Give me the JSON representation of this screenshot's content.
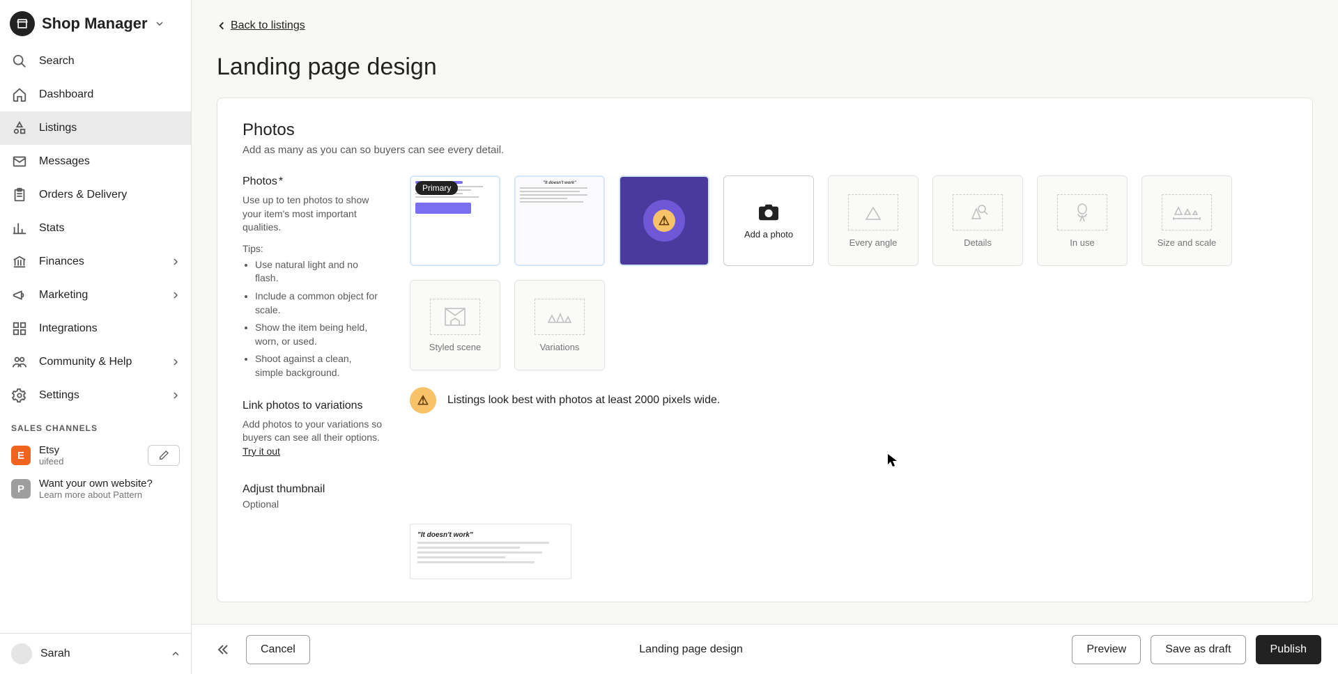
{
  "header": {
    "title": "Shop Manager"
  },
  "sidebar": {
    "items": [
      {
        "label": "Search",
        "icon": "search-icon"
      },
      {
        "label": "Dashboard",
        "icon": "home-icon"
      },
      {
        "label": "Listings",
        "icon": "shapes-icon",
        "active": true
      },
      {
        "label": "Messages",
        "icon": "mail-icon"
      },
      {
        "label": "Orders & Delivery",
        "icon": "clipboard-icon"
      },
      {
        "label": "Stats",
        "icon": "stats-icon"
      },
      {
        "label": "Finances",
        "icon": "bank-icon",
        "chevron": true
      },
      {
        "label": "Marketing",
        "icon": "megaphone-icon",
        "chevron": true
      },
      {
        "label": "Integrations",
        "icon": "apps-icon"
      },
      {
        "label": "Community & Help",
        "icon": "community-icon",
        "chevron": true
      },
      {
        "label": "Settings",
        "icon": "gear-icon",
        "chevron": true
      }
    ],
    "sales_channels_label": "SALES CHANNELS",
    "channels": [
      {
        "badge": "E",
        "name": "Etsy",
        "sub": "uifeed",
        "color": "channel-etsy",
        "edit": true
      },
      {
        "badge": "P",
        "name": "Want your own website?",
        "sub": "Learn more about Pattern",
        "color": "channel-pattern"
      }
    ],
    "footer": {
      "name": "Sarah"
    }
  },
  "main": {
    "back_label": "Back to listings",
    "page_title": "Landing page design",
    "photos_card": {
      "title": "Photos",
      "subtitle": "Add as many as you can so buyers can see every detail.",
      "left_heading": "Photos",
      "required_mark": "*",
      "left_desc": "Use up to ten photos to show your item's most important qualities.",
      "tips_label": "Tips:",
      "tips": [
        "Use natural light and no flash.",
        "Include a common object for scale.",
        "Show the item being held, worn, or used.",
        "Shoot against a clean, simple background."
      ],
      "primary_tag": "Primary",
      "add_photo_label": "Add a photo",
      "placeholders": [
        "Every angle",
        "Details",
        "In use",
        "Size and scale",
        "Styled scene",
        "Variations"
      ],
      "warning_text": "Listings look best with photos at least 2000 pixels wide.",
      "link_heading": "Link photos to variations",
      "link_desc": "Add photos to your variations so buyers can see all their options. ",
      "tryit": "Try it out",
      "adjust_heading": "Adjust thumbnail",
      "adjust_optional": "Optional",
      "adjust_thumb_text": "\"It doesn't work\""
    }
  },
  "footer": {
    "cancel": "Cancel",
    "title": "Landing page design",
    "preview": "Preview",
    "save_draft": "Save as draft",
    "publish": "Publish"
  }
}
